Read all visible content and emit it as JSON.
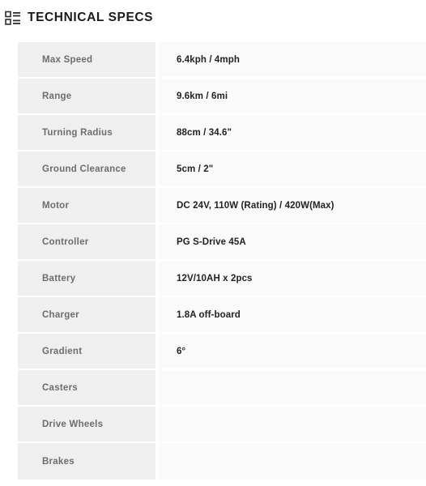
{
  "header": {
    "icon": "spec-list-icon",
    "title": "TECHNICAL SPECS"
  },
  "colors": {
    "page_background": "#ffffff",
    "label_cell_background": "#efefef",
    "value_cell_background": "#fafafa",
    "row_divider": "#ffffff",
    "label_text": "#6d6d6d",
    "value_text": "#222222",
    "title_text": "#1b1b1b"
  },
  "spec_table": {
    "rows": [
      {
        "label": "Max Speed",
        "value": "6.4kph / 4mph"
      },
      {
        "label": "Range",
        "value": "9.6km / 6mi"
      },
      {
        "label": "Turning Radius",
        "value": "88cm / 34.6\""
      },
      {
        "label": "Ground Clearance",
        "value": "5cm / 2\""
      },
      {
        "label": "Motor",
        "value": "DC 24V, 110W (Rating) / 420W(Max)"
      },
      {
        "label": "Controller",
        "value": "PG S-Drive 45A"
      },
      {
        "label": "Battery",
        "value": "12V/10AH x 2pcs"
      },
      {
        "label": "Charger",
        "value": "1.8A off-board"
      },
      {
        "label": "Gradient",
        "value": "6°"
      },
      {
        "label": "Casters",
        "value": ""
      },
      {
        "label": "Drive Wheels",
        "value": ""
      },
      {
        "label": "Brakes",
        "value": ""
      }
    ]
  }
}
